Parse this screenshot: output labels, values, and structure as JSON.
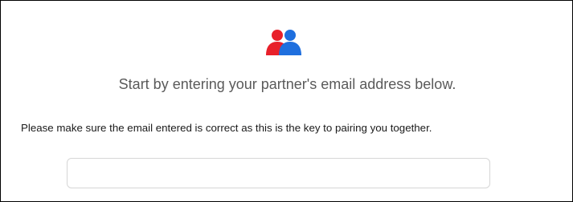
{
  "header": {
    "icon": "users-icon",
    "icon_colors": {
      "left_person": "#e8202a",
      "right_person": "#1f6fde"
    }
  },
  "main": {
    "headline": "Start by entering your partner's email address below.",
    "note": "Please make sure the email entered is correct as this is the key to pairing you together."
  },
  "form": {
    "email_value": "",
    "email_placeholder": ""
  }
}
